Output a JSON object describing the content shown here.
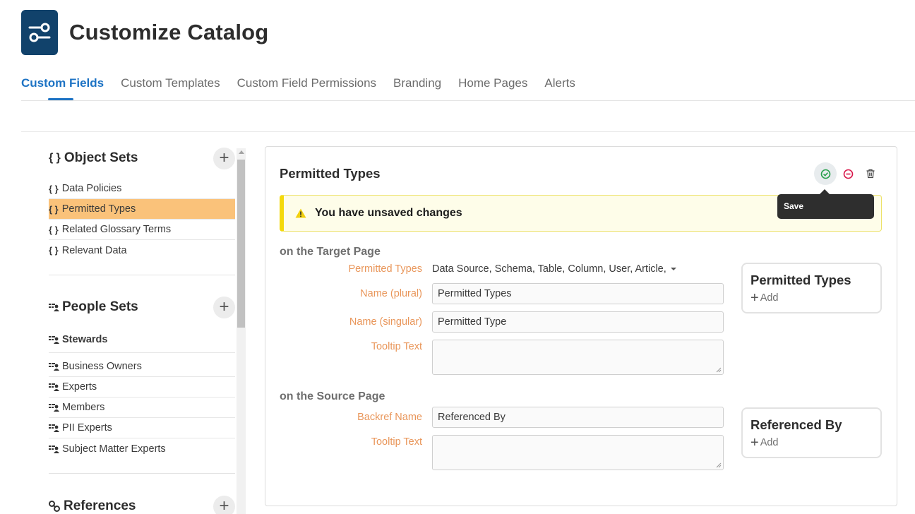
{
  "header": {
    "title": "Customize Catalog",
    "logo_icon": "sliders-icon",
    "logo_color": "#11426b"
  },
  "tabs": [
    {
      "label": "Custom Fields",
      "active": true
    },
    {
      "label": "Custom Templates",
      "active": false
    },
    {
      "label": "Custom Field Permissions",
      "active": false
    },
    {
      "label": "Branding",
      "active": false
    },
    {
      "label": "Home Pages",
      "active": false
    },
    {
      "label": "Alerts",
      "active": false
    }
  ],
  "sidebar": {
    "object_sets": {
      "title": "Object Sets",
      "icon": "{ }",
      "items": [
        "Data Policies",
        "Permitted Types",
        "Related Glossary Terms",
        "Relevant Data"
      ],
      "active_index": 1
    },
    "people_sets": {
      "title": "People Sets",
      "stewards": "Stewards",
      "items": [
        "Business Owners",
        "Experts",
        "Members",
        "PII Experts",
        "Subject Matter Experts"
      ]
    },
    "references": {
      "title": "References"
    },
    "add_symbol": "+"
  },
  "editor": {
    "title": "Permitted Types",
    "tooltip": "Save",
    "warning": "You have unsaved changes",
    "target": {
      "heading": "on the Target Page",
      "permitted_types_label": "Permitted Types",
      "permitted_types_value": "Data Source, Schema, Table, Column, User, Article,",
      "name_plural_label": "Name (plural)",
      "name_plural_value": "Permitted Types",
      "name_singular_label": "Name (singular)",
      "name_singular_value": "Permitted Type",
      "tooltip_label": "Tooltip Text",
      "preview_title": "Permitted Types",
      "preview_add": "Add"
    },
    "source": {
      "heading": "on the Source Page",
      "backref_label": "Backref Name",
      "backref_value": "Referenced By",
      "tooltip_label": "Tooltip Text",
      "preview_title": "Referenced By",
      "preview_add": "Add"
    }
  },
  "colors": {
    "accent": "#1d73c4",
    "active_row": "#fac27a",
    "label": "#e9965a",
    "warning_border": "#f4d90b"
  }
}
